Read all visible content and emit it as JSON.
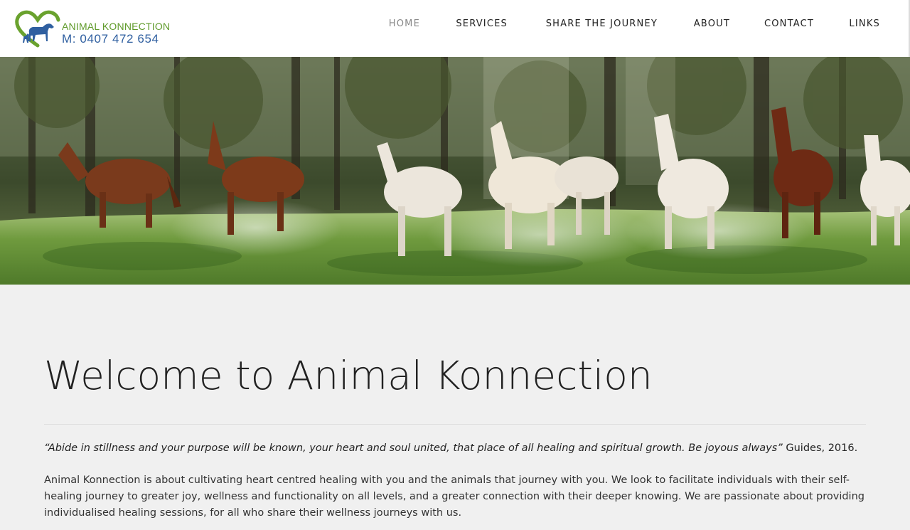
{
  "header": {
    "logo": {
      "name": "ANIMAL KONNECTION",
      "phone": "M: 0407 472 654"
    },
    "nav": [
      {
        "label": "HOME",
        "active": true
      },
      {
        "label": "SERVICES",
        "active": false
      },
      {
        "label": "SHARE THE JOURNEY",
        "active": false
      },
      {
        "label": "ABOUT",
        "active": false
      },
      {
        "label": "CONTACT",
        "active": false
      },
      {
        "label": "LINKS",
        "active": false
      }
    ]
  },
  "hero": {
    "image": "horses-running-in-field"
  },
  "main": {
    "title": "Welcome to Animal Konnection",
    "quote_text": "“Abide in stillness and your purpose will be known, your heart and soul united, that place of all healing and spiritual growth. Be joyous always”",
    "quote_attribution": " Guides, 2016.",
    "paragraph": "Animal Konnection is about cultivating heart centred healing with you and the animals that journey with you. We look to facilitate individuals with their self-healing journey to greater joy, wellness and functionality on all levels, and a greater connection with their deeper knowing. We are passionate about providing individualised healing sessions, for all who share their wellness journeys with us."
  },
  "colors": {
    "logo_green": "#5f9a2a",
    "logo_blue": "#2f5fa0",
    "nav_active": "#888888",
    "page_bg": "#f0f0f0"
  }
}
